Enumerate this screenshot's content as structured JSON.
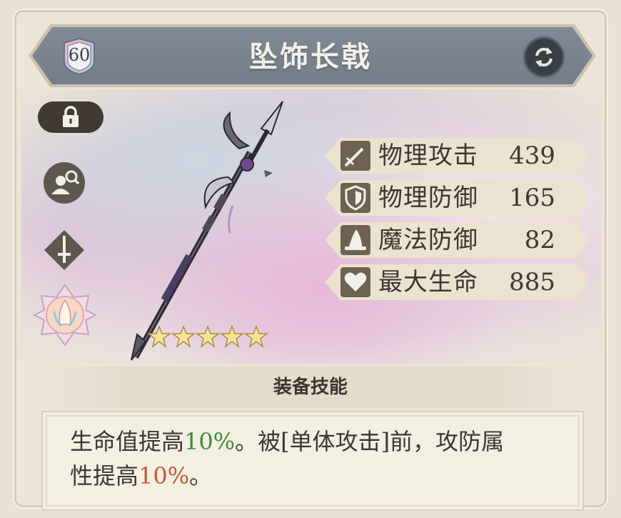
{
  "item": {
    "name": "坠饰长戟",
    "level": "60",
    "star_rating": 5
  },
  "stats": [
    {
      "icon": "sword-icon",
      "label": "物理攻击",
      "value": "439"
    },
    {
      "icon": "shield-icon",
      "label": "物理防御",
      "value": "165"
    },
    {
      "icon": "wizard-hat-icon",
      "label": "魔法防御",
      "value": "82"
    },
    {
      "icon": "heart-icon",
      "label": "最大生命",
      "value": "885"
    }
  ],
  "skill": {
    "section_title": "装备技能",
    "text_part1": "生命值提高",
    "highlight1": "10%",
    "text_part2": "。被[单体攻击]前，攻防属",
    "text_part3": "性提高",
    "highlight2": "10%",
    "text_part4": "。"
  },
  "colors": {
    "title_bar": "#7b8590",
    "stat_icon_bg": "#6e6353",
    "highlight_green": "#3f8f3a",
    "highlight_red": "#c5583c"
  },
  "icons": {
    "lock": "lock-icon",
    "swap": "swap-icon",
    "inspect": "character-search-icon",
    "weapon_type": "sword-diamond-icon",
    "element": "lotus-emblem-icon"
  }
}
